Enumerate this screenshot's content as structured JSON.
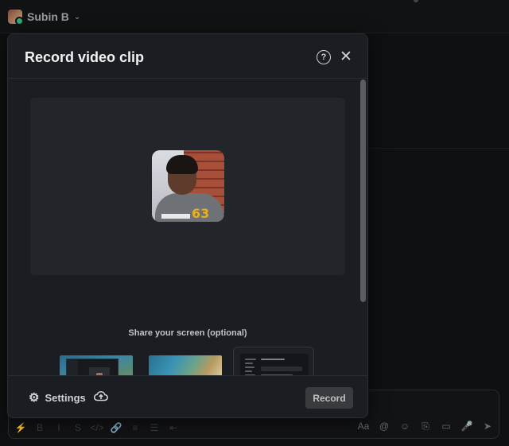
{
  "background": {
    "username": "Subin B",
    "composer_tools": [
      "⚡",
      "B",
      "I",
      "S",
      "</>",
      "🔗",
      "≡",
      "☰",
      "⇤"
    ],
    "composer_right_tools": [
      "Aa",
      "@",
      "☺",
      "⎘",
      "▭",
      "🎤",
      "➤"
    ]
  },
  "modal": {
    "title": "Record video clip",
    "help_icon": "question-icon",
    "close_icon": "close-icon",
    "share_label": "Share your screen (optional)",
    "screens": [
      {
        "name": "screen-thumbnail-1",
        "selected": false
      },
      {
        "name": "screen-thumbnail-2",
        "selected": false
      },
      {
        "name": "screen-thumbnail-3",
        "selected": true
      }
    ],
    "footer": {
      "settings_label": "Settings",
      "record_label": "Record"
    }
  },
  "colors": {
    "modal_bg": "#1a1d21",
    "preview_bg": "#222529",
    "record_button": "#393b3f",
    "text_primary": "#f2f2f2"
  }
}
